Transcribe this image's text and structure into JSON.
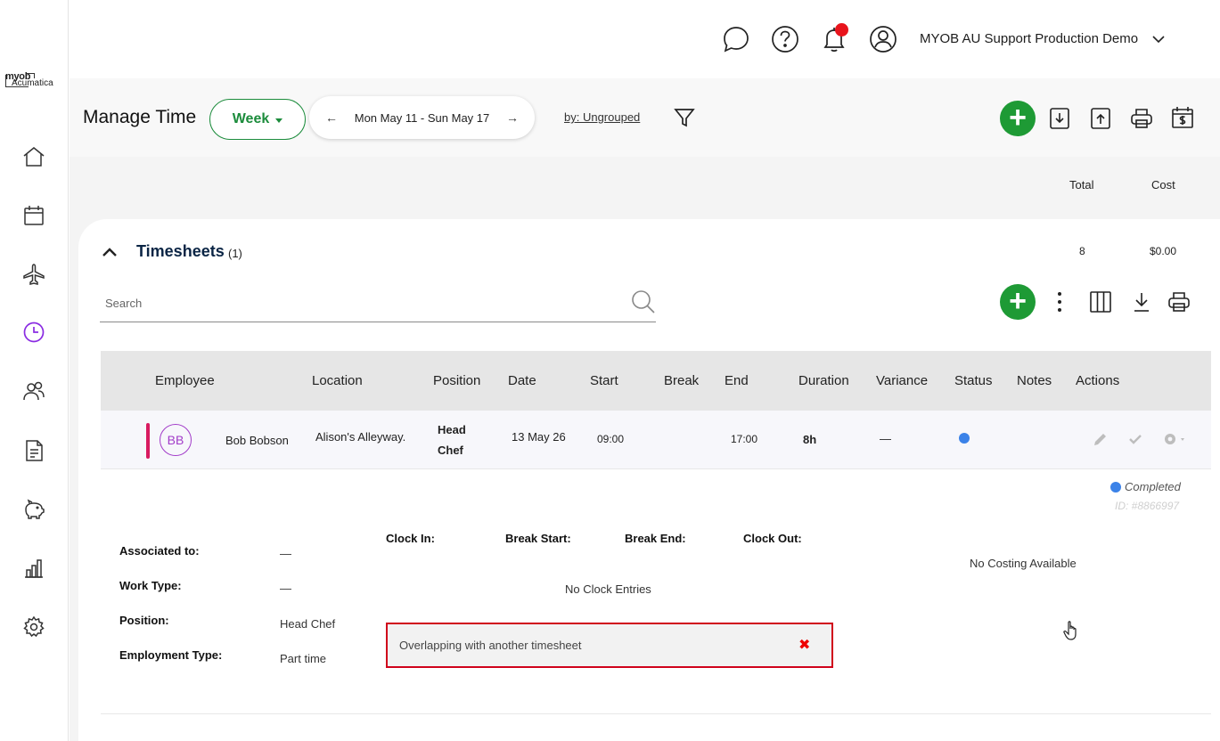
{
  "sidebar": {
    "logo_top": "myob",
    "logo_bottom": "Acumatica",
    "items": [
      {
        "name": "home-icon"
      },
      {
        "name": "calendar-icon"
      },
      {
        "name": "plane-icon"
      },
      {
        "name": "clock-icon",
        "active": true
      },
      {
        "name": "people-icon"
      },
      {
        "name": "document-icon"
      },
      {
        "name": "piggy-bank-icon"
      },
      {
        "name": "bar-chart-icon"
      },
      {
        "name": "gear-icon"
      }
    ],
    "active_color": "#8a2be2"
  },
  "header": {
    "company": "MYOB AU Support Production Demo",
    "notification_color": "#e8141c"
  },
  "toolbar": {
    "title": "Manage Time",
    "view": "Week",
    "prev_arrow": "←",
    "next_arrow": "→",
    "date_range": "Mon May 11 - Sun May 17",
    "group_by": "by: Ungrouped",
    "accent": "#1e9a35"
  },
  "summary": {
    "total_label": "Total",
    "cost_label": "Cost",
    "total_value": "8",
    "cost_value": "$0.00"
  },
  "timesheets": {
    "title": "Timesheets",
    "count": "(1)",
    "search_placeholder": "Search",
    "columns": [
      "Employee",
      "Location",
      "Position",
      "Date",
      "Start",
      "Break",
      "End",
      "Duration",
      "Variance",
      "Status",
      "Notes",
      "Actions"
    ],
    "row": {
      "initials": "BB",
      "employee": "Bob Bobson",
      "location": "Alison's Alleyway.",
      "position_line1": "Head",
      "position_line2": "Chef",
      "date": "13 May 26",
      "start": "09:00",
      "break": "",
      "end": "17:00",
      "duration": "8h",
      "variance": "—",
      "status_color": "#3b82e8"
    }
  },
  "details": {
    "status": "Completed",
    "id": "ID: #8866997",
    "associated_label": "Associated to:",
    "associated_value": "—",
    "work_type_label": "Work Type:",
    "work_type_value": "—",
    "position_label": "Position:",
    "position_value": "Head Chef",
    "employment_label": "Employment Type:",
    "employment_value": "Part time",
    "clock_in": "Clock In:",
    "break_start": "Break Start:",
    "break_end": "Break End:",
    "clock_out": "Clock Out:",
    "no_clock": "No Clock Entries",
    "no_costing": "No Costing Available",
    "error": "Overlapping with another timesheet",
    "error_close": "✖"
  }
}
